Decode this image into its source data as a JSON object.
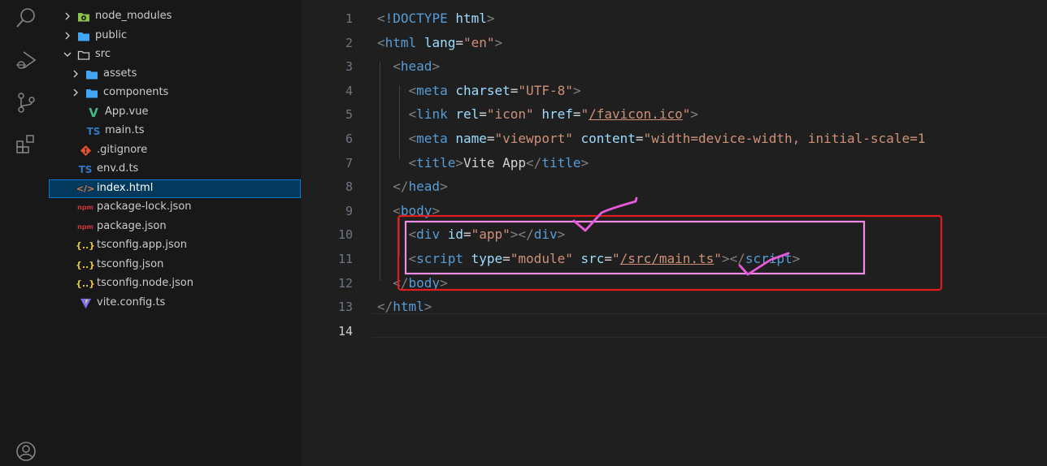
{
  "explorer": {
    "items": [
      {
        "label": "node_modules",
        "kind": "folder-special",
        "expanded": false,
        "depth": 0
      },
      {
        "label": "public",
        "kind": "folder",
        "expanded": false,
        "depth": 0
      },
      {
        "label": "src",
        "kind": "folder-open",
        "expanded": true,
        "depth": 0
      },
      {
        "label": "assets",
        "kind": "folder",
        "expanded": false,
        "depth": 1
      },
      {
        "label": "components",
        "kind": "folder",
        "expanded": false,
        "depth": 1
      },
      {
        "label": "App.vue",
        "kind": "vue",
        "icon_text": "V",
        "depth": 1
      },
      {
        "label": "main.ts",
        "kind": "ts",
        "icon_text": "TS",
        "depth": 1
      },
      {
        "label": ".gitignore",
        "kind": "git",
        "depth": 0
      },
      {
        "label": "env.d.ts",
        "kind": "ts",
        "icon_text": "TS",
        "depth": 0
      },
      {
        "label": "index.html",
        "kind": "html",
        "icon_text": "</>",
        "depth": 0,
        "selected": true
      },
      {
        "label": "package-lock.json",
        "kind": "npm",
        "icon_text": "npm",
        "depth": 0
      },
      {
        "label": "package.json",
        "kind": "npm",
        "icon_text": "npm",
        "depth": 0
      },
      {
        "label": "tsconfig.app.json",
        "kind": "json",
        "icon_text": "{..}",
        "depth": 0
      },
      {
        "label": "tsconfig.json",
        "kind": "json",
        "icon_text": "{..}",
        "depth": 0
      },
      {
        "label": "tsconfig.node.json",
        "kind": "json",
        "icon_text": "{..}",
        "depth": 0
      },
      {
        "label": "vite.config.ts",
        "kind": "vite",
        "depth": 0
      }
    ]
  },
  "activity_bar": {
    "icons": [
      "search-icon",
      "run-debug-icon",
      "source-control-icon",
      "extensions-icon",
      "account-icon"
    ]
  },
  "editor": {
    "active_line": 14,
    "line_numbers": [
      "1",
      "2",
      "3",
      "4",
      "5",
      "6",
      "7",
      "8",
      "9",
      "10",
      "11",
      "12",
      "13",
      "14"
    ],
    "lines": [
      [
        [
          "punct",
          "<"
        ],
        [
          "tag",
          "!DOCTYPE"
        ],
        [
          "text",
          " "
        ],
        [
          "attr",
          "html"
        ],
        [
          "punct",
          ">"
        ]
      ],
      [
        [
          "punct",
          "<"
        ],
        [
          "tag",
          "html"
        ],
        [
          "text",
          " "
        ],
        [
          "attr",
          "lang"
        ],
        [
          "text",
          "="
        ],
        [
          "str",
          "\"en\""
        ],
        [
          "punct",
          ">"
        ]
      ],
      [
        [
          "text",
          "  "
        ],
        [
          "punct",
          "<"
        ],
        [
          "tag",
          "head"
        ],
        [
          "punct",
          ">"
        ]
      ],
      [
        [
          "text",
          "    "
        ],
        [
          "punct",
          "<"
        ],
        [
          "tag",
          "meta"
        ],
        [
          "text",
          " "
        ],
        [
          "attr",
          "charset"
        ],
        [
          "text",
          "="
        ],
        [
          "str",
          "\"UTF-8\""
        ],
        [
          "punct",
          ">"
        ]
      ],
      [
        [
          "text",
          "    "
        ],
        [
          "punct",
          "<"
        ],
        [
          "tag",
          "link"
        ],
        [
          "text",
          " "
        ],
        [
          "attr",
          "rel"
        ],
        [
          "text",
          "="
        ],
        [
          "str",
          "\"icon\""
        ],
        [
          "text",
          " "
        ],
        [
          "attr",
          "href"
        ],
        [
          "text",
          "="
        ],
        [
          "str",
          "\""
        ],
        [
          "link",
          "/favicon.ico"
        ],
        [
          "str",
          "\""
        ],
        [
          "punct",
          ">"
        ]
      ],
      [
        [
          "text",
          "    "
        ],
        [
          "punct",
          "<"
        ],
        [
          "tag",
          "meta"
        ],
        [
          "text",
          " "
        ],
        [
          "attr",
          "name"
        ],
        [
          "text",
          "="
        ],
        [
          "str",
          "\"viewport\""
        ],
        [
          "text",
          " "
        ],
        [
          "attr",
          "content"
        ],
        [
          "text",
          "="
        ],
        [
          "str",
          "\"width=device-width, initial-scale=1"
        ]
      ],
      [
        [
          "text",
          "    "
        ],
        [
          "punct",
          "<"
        ],
        [
          "tag",
          "title"
        ],
        [
          "punct",
          ">"
        ],
        [
          "text",
          "Vite App"
        ],
        [
          "punct",
          "</"
        ],
        [
          "tag",
          "title"
        ],
        [
          "punct",
          ">"
        ]
      ],
      [
        [
          "text",
          "  "
        ],
        [
          "punct",
          "</"
        ],
        [
          "tag",
          "head"
        ],
        [
          "punct",
          ">"
        ]
      ],
      [
        [
          "text",
          "  "
        ],
        [
          "punct",
          "<"
        ],
        [
          "tag",
          "body"
        ],
        [
          "punct",
          ">"
        ]
      ],
      [
        [
          "text",
          "    "
        ],
        [
          "punct",
          "<"
        ],
        [
          "tag",
          "div"
        ],
        [
          "text",
          " "
        ],
        [
          "attr",
          "id"
        ],
        [
          "text",
          "="
        ],
        [
          "str",
          "\"app\""
        ],
        [
          "punct",
          "></"
        ],
        [
          "tag",
          "div"
        ],
        [
          "punct",
          ">"
        ]
      ],
      [
        [
          "text",
          "    "
        ],
        [
          "punct",
          "<"
        ],
        [
          "tag",
          "script"
        ],
        [
          "text",
          " "
        ],
        [
          "attr",
          "type"
        ],
        [
          "text",
          "="
        ],
        [
          "str",
          "\"module\""
        ],
        [
          "text",
          " "
        ],
        [
          "attr",
          "src"
        ],
        [
          "text",
          "="
        ],
        [
          "str",
          "\""
        ],
        [
          "link",
          "/src/main.ts"
        ],
        [
          "str",
          "\""
        ],
        [
          "punct",
          "></"
        ],
        [
          "tag",
          "script"
        ],
        [
          "punct",
          ">"
        ]
      ],
      [
        [
          "text",
          "  "
        ],
        [
          "punct",
          "</"
        ],
        [
          "tag",
          "body"
        ],
        [
          "punct",
          ">"
        ]
      ],
      [
        [
          "punct",
          "</"
        ],
        [
          "tag",
          "html"
        ],
        [
          "punct",
          ">"
        ]
      ],
      []
    ]
  },
  "annotations": {
    "red_box_color": "#e01c1c",
    "pink_box_color": "#f08ae6",
    "check_color": "#e85ad9"
  }
}
